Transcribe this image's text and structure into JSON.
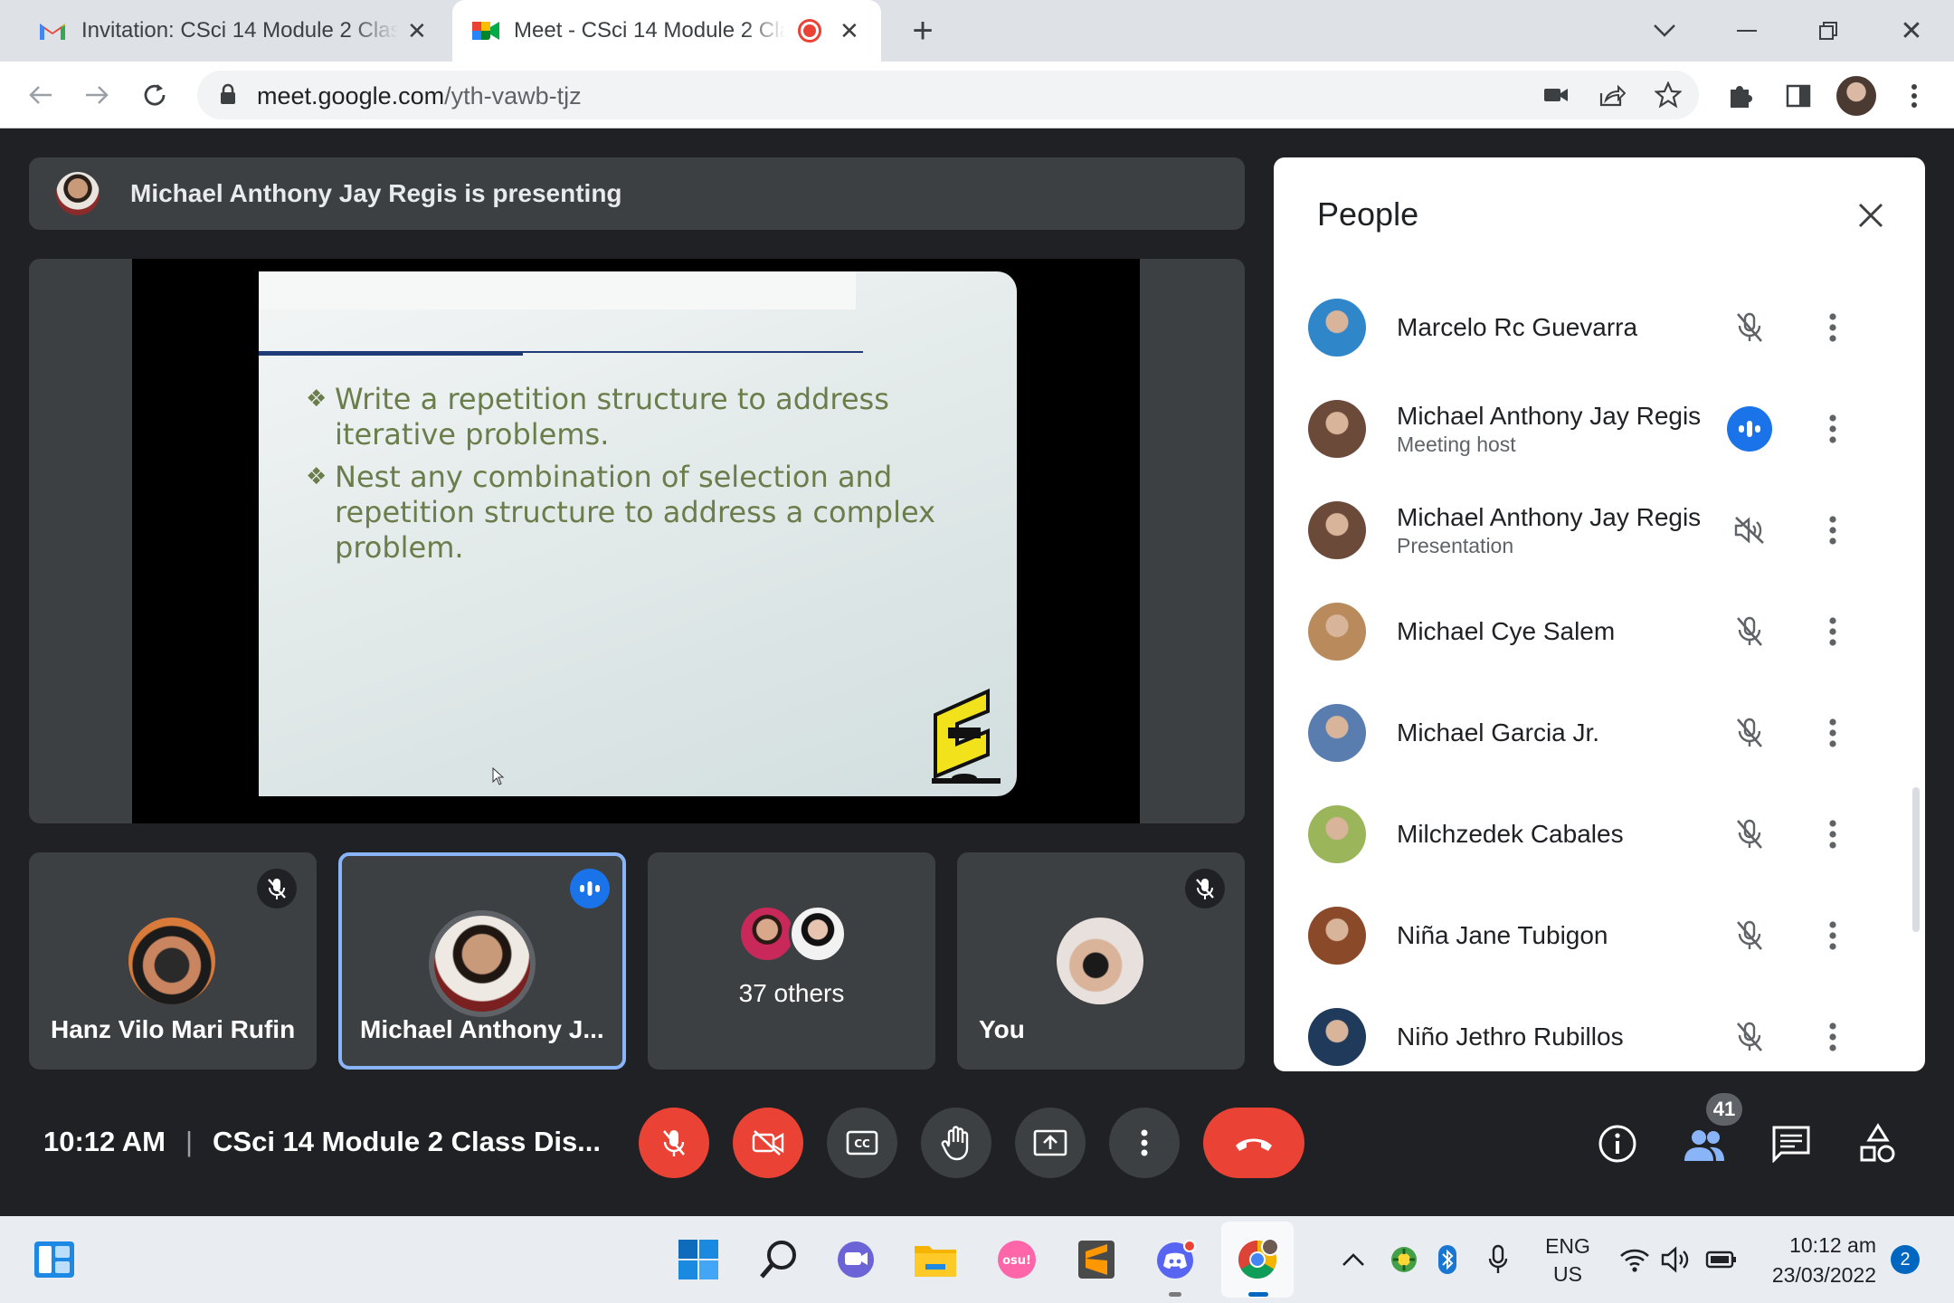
{
  "browser": {
    "tabs": [
      {
        "title": "Invitation: CSci 14 Module 2 Class"
      },
      {
        "title": "Meet - CSci 14 Module 2 Cla"
      }
    ],
    "url_host": "meet.google.com",
    "url_path": "/yth-vawb-tjz"
  },
  "meet": {
    "presenting_banner": "Michael Anthony Jay Regis is presenting",
    "slide": {
      "bullets": [
        "Write a repetition structure to address iterative problems.",
        "Nest any combination of selection and repetition structure to address a complex problem."
      ],
      "bullet_marker": "❖"
    },
    "tiles": [
      {
        "name": "Hanz Vilo Mari Rufin",
        "muted": true
      },
      {
        "name": "Michael Anthony J...",
        "speaking": true
      },
      {
        "name": "37 others"
      },
      {
        "name": "You",
        "muted": true
      }
    ],
    "time": "10:12 AM",
    "separator": "|",
    "meeting_title": "CSci 14 Module 2 Class Dis...",
    "participant_count": "41"
  },
  "people": {
    "title": "People",
    "list": [
      {
        "name": "Marcelo Rc Guevarra",
        "sub": "",
        "status": "muted",
        "avatar_color": "#2f86c9"
      },
      {
        "name": "Michael Anthony Jay Regis",
        "sub": "Meeting host",
        "status": "speaking",
        "avatar_color": "#6b4a3a"
      },
      {
        "name": "Michael Anthony Jay Regis",
        "sub": "Presentation",
        "status": "presentation",
        "avatar_color": "#6b4a3a"
      },
      {
        "name": "Michael Cye Salem",
        "sub": "",
        "status": "muted",
        "avatar_color": "#b88a5c"
      },
      {
        "name": "Michael Garcia Jr.",
        "sub": "",
        "status": "muted",
        "avatar_color": "#5a7db0"
      },
      {
        "name": "Milchzedek Cabales",
        "sub": "",
        "status": "muted",
        "avatar_color": "#9bb55a"
      },
      {
        "name": "Niña Jane Tubigon",
        "sub": "",
        "status": "muted",
        "avatar_color": "#8a4a2a"
      },
      {
        "name": "Niño Jethro Rubillos",
        "sub": "",
        "status": "muted",
        "avatar_color": "#1f3a5a"
      }
    ]
  },
  "taskbar": {
    "lang_top": "ENG",
    "lang_bottom": "US",
    "clock_time": "10:12 am",
    "clock_date": "23/03/2022",
    "notification_count": "2"
  },
  "colors": {
    "meet_bg": "#202124",
    "tile_bg": "#3c4043",
    "danger": "#ea4335",
    "accent": "#1a73e8"
  }
}
